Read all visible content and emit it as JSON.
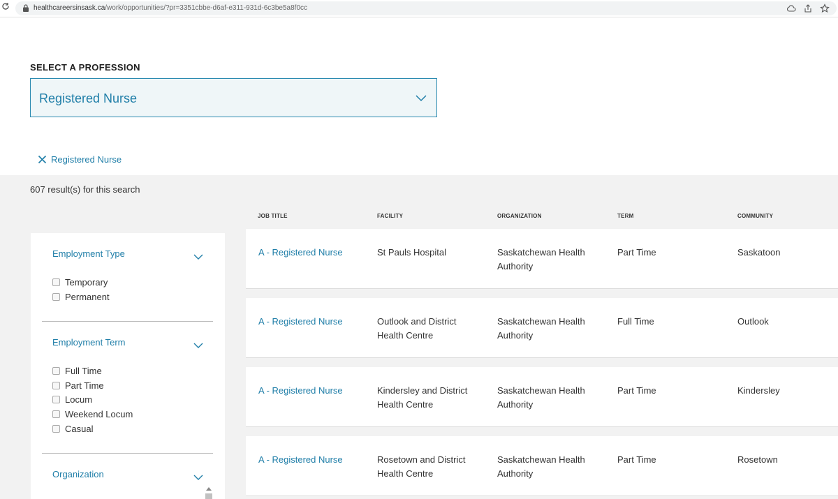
{
  "browser": {
    "url_domain": "healthcareersinsask.ca",
    "url_path": "/work/opportunities/?pr=3351cbbe-d6af-e311-931d-6c3be5a8f0cc"
  },
  "profession": {
    "label": "SELECT A PROFESSION",
    "selected": "Registered Nurse"
  },
  "applied_filter": "Registered Nurse",
  "results_count": "607 result(s) for this search",
  "filters": {
    "employment_type": {
      "title": "Employment Type",
      "options": [
        "Temporary",
        "Permanent"
      ]
    },
    "employment_term": {
      "title": "Employment Term",
      "options": [
        "Full Time",
        "Part Time",
        "Locum",
        "Weekend Locum",
        "Casual"
      ]
    },
    "organization": {
      "title": "Organization"
    }
  },
  "table": {
    "headers": [
      "JOB TITLE",
      "FACILITY",
      "ORGANIZATION",
      "TERM",
      "COMMUNITY"
    ],
    "rows": [
      {
        "title": "A - Registered Nurse",
        "facility": "St Pauls Hospital",
        "organization": "Saskatchewan Health Authority",
        "term": "Part Time",
        "community": "Saskatoon"
      },
      {
        "title": "A - Registered Nurse",
        "facility": "Outlook and District Health Centre",
        "organization": "Saskatchewan Health Authority",
        "term": "Full Time",
        "community": "Outlook"
      },
      {
        "title": "A - Registered Nurse",
        "facility": "Kindersley and District Health Centre",
        "organization": "Saskatchewan Health Authority",
        "term": "Part Time",
        "community": "Kindersley"
      },
      {
        "title": "A - Registered Nurse",
        "facility": "Rosetown and District Health Centre",
        "organization": "Saskatchewan Health Authority",
        "term": "Part Time",
        "community": "Rosetown"
      }
    ]
  },
  "colors": {
    "link": "#1f7ea8",
    "select_border": "#2a8ab0",
    "select_bg": "#eff6f8",
    "results_bg": "#f2f2f2"
  }
}
